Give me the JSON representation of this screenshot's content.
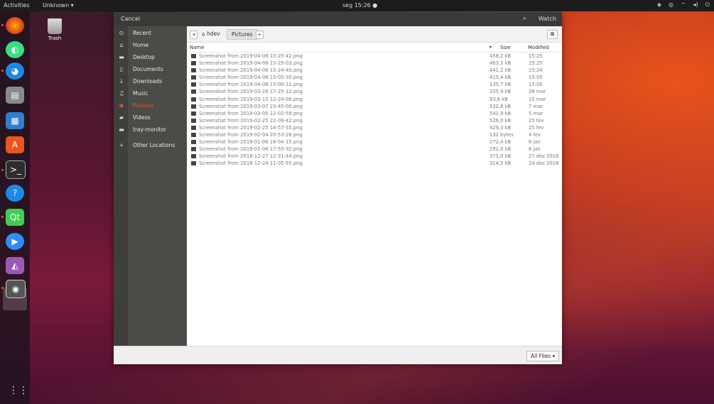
{
  "topbar": {
    "activities": "Activities",
    "app_menu": "Unknown ▾",
    "clock": "seg 15:26 ●"
  },
  "desktop": {
    "trash_label": "Trash"
  },
  "dialog": {
    "cancel_label": "Cancel",
    "title_right": "Watch",
    "sidebar": [
      {
        "icon": "clock-icon",
        "glyph": "⊙",
        "label": "Recent"
      },
      {
        "icon": "home-icon",
        "glyph": "⌂",
        "label": "Home"
      },
      {
        "icon": "folder-icon",
        "glyph": "▬",
        "label": "Desktop"
      },
      {
        "icon": "document-icon",
        "glyph": "▯",
        "label": "Documents"
      },
      {
        "icon": "download-icon",
        "glyph": "↓",
        "label": "Downloads"
      },
      {
        "icon": "music-icon",
        "glyph": "♫",
        "label": "Music"
      },
      {
        "icon": "camera-icon",
        "glyph": "◉",
        "label": "Pictures"
      },
      {
        "icon": "video-icon",
        "glyph": "▰",
        "label": "Videos"
      },
      {
        "icon": "folder-icon",
        "glyph": "▬",
        "label": "tray-monitor"
      },
      {
        "icon": "plus-icon",
        "glyph": "+",
        "label": "Other Locations"
      }
    ],
    "path": {
      "home": "⌂ hdev",
      "current": "Pictures"
    },
    "columns": {
      "name": "Name",
      "size": "Size",
      "modified": "Modified"
    },
    "files": [
      {
        "name": "Screenshot from 2019-04-08 15-25-42.png",
        "size": "458,2 kB",
        "modified": "15:25"
      },
      {
        "name": "Screenshot from 2019-04-08 15-25-03.png",
        "size": "463,1 kB",
        "modified": "15:25"
      },
      {
        "name": "Screenshot from 2019-04-08 15-24-40.png",
        "size": "441,2 kB",
        "modified": "15:24"
      },
      {
        "name": "Screenshot from 2019-04-08 15-05-30.png",
        "size": "415,4 kB",
        "modified": "15:05"
      },
      {
        "name": "Screenshot from 2019-04-08 15-00-11.png",
        "size": "135,7 kB",
        "modified": "15:00"
      },
      {
        "name": "Screenshot from 2019-03-26 17-25-12.png",
        "size": "335,9 kB",
        "modified": "26 mar"
      },
      {
        "name": "Screenshot from 2019-03-15 12-24-06.png",
        "size": "93,6 kB",
        "modified": "15 mar"
      },
      {
        "name": "Screenshot from 2019-03-07 23-45-00.png",
        "size": "532,8 kB",
        "modified": "7 mar"
      },
      {
        "name": "Screenshot from 2019-03-05 12-02-59.png",
        "size": "541,9 kB",
        "modified": "5 mar"
      },
      {
        "name": "Screenshot from 2019-02-25 22-09-42.png",
        "size": "526,0 kB",
        "modified": "25 fev"
      },
      {
        "name": "Screenshot from 2019-02-25 14-57-55.png",
        "size": "429,3 kB",
        "modified": "25 fev"
      },
      {
        "name": "Screenshot from 2019-02-04 20-53-26.png",
        "size": "132 bytes",
        "modified": "4 fev"
      },
      {
        "name": "Screenshot from 2019-01-06 18-04-15.png",
        "size": "272,4 kB",
        "modified": "6 jan"
      },
      {
        "name": "Screenshot from 2019-01-06 17-55-32.png",
        "size": "291,0 kB",
        "modified": "6 jan"
      },
      {
        "name": "Screenshot from 2018-12-27 12-31-44.png",
        "size": "371,0 kB",
        "modified": "27 dez 2018"
      },
      {
        "name": "Screenshot from 2018-12-24 11-05-55.png",
        "size": "314,5 kB",
        "modified": "24 dez 2018"
      }
    ],
    "filter_label": "All Files ▾"
  },
  "colors": {
    "accent": "#e95420",
    "headerbar": "#3a3a38",
    "sidebar": "#4b4b47"
  }
}
